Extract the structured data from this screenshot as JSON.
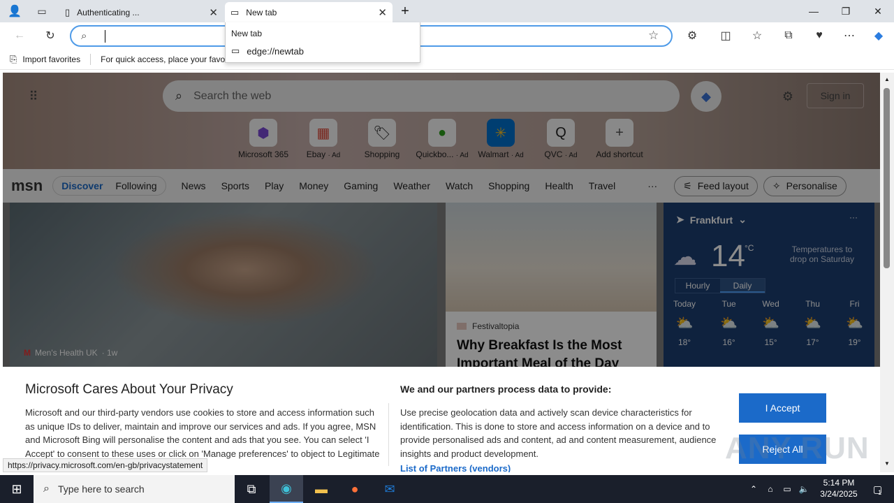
{
  "browser": {
    "tabs": [
      {
        "title": "Authenticating ...",
        "close": "✕"
      },
      {
        "title": "New tab",
        "close": "✕"
      }
    ],
    "new_tab_glyph": "+",
    "window_controls": {
      "minimize": "—",
      "restore": "❐",
      "close": "✕"
    },
    "address_value": "",
    "suggestion": {
      "header": "New tab",
      "item": "edge://newtab"
    },
    "favorites": {
      "import_label": "Import favorites",
      "hint": "For quick access, place your favori"
    },
    "status_url": "https://privacy.microsoft.com/en-gb/privacystatement"
  },
  "newtab": {
    "search_placeholder": "Search the web",
    "sign_in": "Sign in",
    "shortcuts": [
      {
        "label": "Microsoft 365",
        "ad": "",
        "icon": "m365-icon"
      },
      {
        "label": "Ebay",
        "ad": "· Ad",
        "icon": "ebay-icon"
      },
      {
        "label": "Shopping",
        "ad": "",
        "icon": "shopping-tag-icon"
      },
      {
        "label": "Quickbo...",
        "ad": "· Ad",
        "icon": "quickbooks-icon"
      },
      {
        "label": "Walmart",
        "ad": "· Ad",
        "icon": "walmart-icon"
      },
      {
        "label": "QVC",
        "ad": "· Ad",
        "icon": "qvc-icon"
      },
      {
        "label": "Add shortcut",
        "ad": "",
        "icon": "plus-icon"
      }
    ]
  },
  "msn": {
    "logo": "msn",
    "pill": [
      "Discover",
      "Following"
    ],
    "nav": [
      "News",
      "Sports",
      "Play",
      "Money",
      "Gaming",
      "Weather",
      "Watch",
      "Shopping",
      "Health",
      "Travel"
    ],
    "more": "···",
    "feed_layout": "Feed layout",
    "personalise": "Personalise",
    "card1": {
      "source": "Men's Health UK",
      "age": "· 1w"
    },
    "card2": {
      "source": "Festivaltopia",
      "title": "Why Breakfast Is the Most Important Meal of the Day"
    },
    "weather": {
      "city": "Frankfurt",
      "temp": "14",
      "unit": "°C",
      "note": "Temperatures to drop on Saturday",
      "tabs": [
        "Hourly",
        "Daily"
      ],
      "days": [
        {
          "day": "Today",
          "temp": "18°"
        },
        {
          "day": "Tue",
          "temp": "16°"
        },
        {
          "day": "Wed",
          "temp": "15°"
        },
        {
          "day": "Thu",
          "temp": "17°"
        },
        {
          "day": "Fri",
          "temp": "19°"
        }
      ]
    }
  },
  "privacy": {
    "title": "Microsoft Cares About Your Privacy",
    "body": "Microsoft and our third-party vendors use cookies to store and access information such as unique IDs to deliver, maintain and improve our services and ads. If you agree, MSN and Microsoft Bing will personalise the content and ads that you see. You can select 'I Accept' to consent to these uses or click on 'Manage preferences' to object to Legitimate Interest where",
    "right_title": "We and our partners process data to provide:",
    "right_body": "Use precise geolocation data and actively scan device characteristics for identification. This is done to store and access information on a device and to provide personalised ads and content, ad and content measurement, audience insights and product development.",
    "partners_link": "List of Partners (vendors)",
    "accept": "I Accept",
    "reject": "Reject All"
  },
  "taskbar": {
    "search_placeholder": "Type here to search",
    "time": "5:14 PM",
    "date": "3/24/2025",
    "notification_count": "1"
  },
  "watermark": "ANY RUN",
  "colors": {
    "accent": "#1b6ac9",
    "address_focus": "#4f9be8",
    "taskbar": "#1a1f2b",
    "weather_card": "#1d3f72"
  }
}
